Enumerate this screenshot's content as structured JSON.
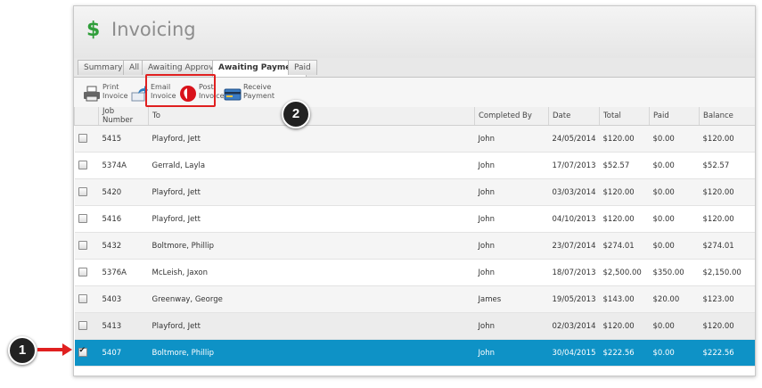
{
  "header": {
    "icon": "dollar-icon",
    "title": "Invoicing",
    "accent": "#2f9e3a"
  },
  "tabs": [
    {
      "label": "Summary"
    },
    {
      "label": "All"
    },
    {
      "label": "Awaiting Approval"
    },
    {
      "label": "Awaiting Payment",
      "active": true
    },
    {
      "label": "Paid"
    }
  ],
  "toolbar": {
    "print": {
      "line1": "Print",
      "line2": "Invoice",
      "icon": "printer-icon"
    },
    "email": {
      "line1": "Email",
      "line2": "Invoice",
      "icon": "email-forward-icon"
    },
    "post": {
      "line1": "Post",
      "line2": "Invoice",
      "icon": "post-icon"
    },
    "receive": {
      "line1": "Receive",
      "line2": "Payment",
      "icon": "payment-card-icon"
    }
  },
  "table": {
    "columns": [
      "Job Number",
      "To",
      "Completed By",
      "Date",
      "Total",
      "Paid",
      "Balance"
    ],
    "rows": [
      {
        "job": "5415",
        "to": "Playford, Jett",
        "by": "John",
        "date": "24/05/2014",
        "total": "$120.00",
        "paid": "$0.00",
        "balance": "$120.00",
        "checked": false
      },
      {
        "job": "5374A",
        "to": "Gerrald, Layla",
        "by": "John",
        "date": "17/07/2013",
        "total": "$52.57",
        "paid": "$0.00",
        "balance": "$52.57",
        "checked": false
      },
      {
        "job": "5420",
        "to": "Playford, Jett",
        "by": "John",
        "date": "03/03/2014",
        "total": "$120.00",
        "paid": "$0.00",
        "balance": "$120.00",
        "checked": false
      },
      {
        "job": "5416",
        "to": "Playford, Jett",
        "by": "John",
        "date": "04/10/2013",
        "total": "$120.00",
        "paid": "$0.00",
        "balance": "$120.00",
        "checked": false
      },
      {
        "job": "5432",
        "to": "Boltmore, Phillip",
        "by": "John",
        "date": "23/07/2014",
        "total": "$274.01",
        "paid": "$0.00",
        "balance": "$274.01",
        "checked": false
      },
      {
        "job": "5376A",
        "to": "McLeish, Jaxon",
        "by": "John",
        "date": "18/07/2013",
        "total": "$2,500.00",
        "paid": "$350.00",
        "balance": "$2,150.00",
        "checked": false
      },
      {
        "job": "5403",
        "to": "Greenway, George",
        "by": "James",
        "date": "19/05/2013",
        "total": "$143.00",
        "paid": "$20.00",
        "balance": "$123.00",
        "checked": false
      },
      {
        "job": "5413",
        "to": "Playford, Jett",
        "by": "John",
        "date": "02/03/2014",
        "total": "$120.00",
        "paid": "$0.00",
        "balance": "$120.00",
        "checked": false
      },
      {
        "job": "5407",
        "to": "Boltmore, Phillip",
        "by": "John",
        "date": "30/04/2015",
        "total": "$222.56",
        "paid": "$0.00",
        "balance": "$222.56",
        "checked": true
      }
    ]
  },
  "annotations": {
    "badge1": "1",
    "badge2": "2",
    "highlight_color": "#e02020",
    "selected_row_color": "#0e92c6"
  }
}
